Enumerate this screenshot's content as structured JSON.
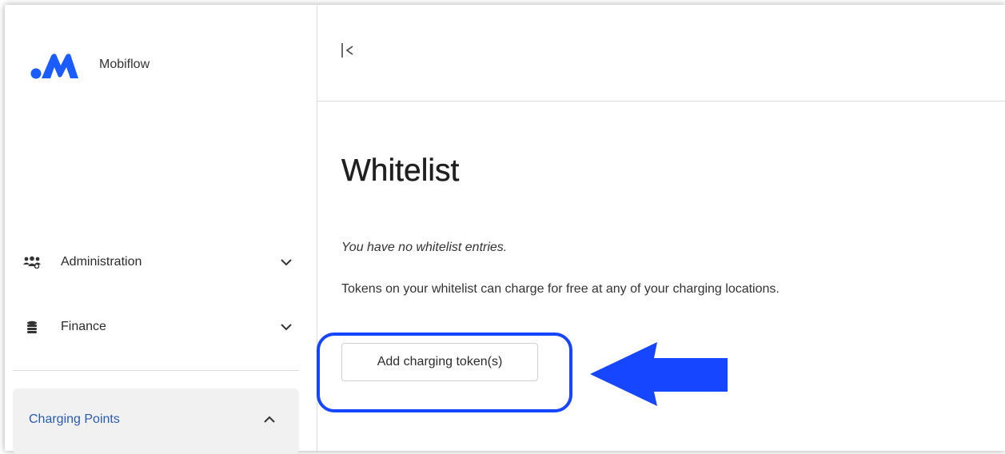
{
  "sidebar": {
    "brand": {
      "name": "Mobiflow",
      "logo_icon": "mobiflow-logo-icon",
      "logo_color": "#1a5cff"
    },
    "items": [
      {
        "label": "Administration",
        "icon": "users-group-icon",
        "expanded": false
      },
      {
        "label": "Finance",
        "icon": "coins-stack-icon",
        "expanded": false
      }
    ],
    "active_item": {
      "label": "Charging Points",
      "expanded": true,
      "color": "#2a5bb0"
    }
  },
  "topbar": {
    "collapse_icon": "collapse-sidebar-icon"
  },
  "main": {
    "title": "Whitelist",
    "empty_message": "You have no whitelist entries.",
    "info_message": "Tokens on your whitelist can charge for free at any of your charging locations.",
    "add_button_label": "Add charging token(s)"
  },
  "annotation": {
    "color": "#1646ff",
    "arrow_icon": "left-arrow-icon",
    "ring": "highlight-ring"
  }
}
